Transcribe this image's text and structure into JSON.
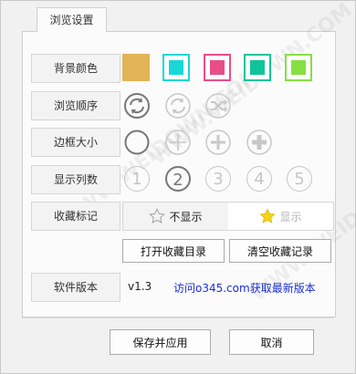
{
  "tab": {
    "label": "浏览设置"
  },
  "labels": {
    "bg_color": "背景颜色",
    "browse_order": "浏览顺序",
    "border_size": "边框大小",
    "columns": "显示列数",
    "favorite_mark": "收藏标记",
    "version": "软件版本"
  },
  "colors": {
    "swatches": [
      "#e2b457",
      "#18d8d8",
      "#e84d8a",
      "#0fc49a",
      "#86e042"
    ],
    "selected_index": 0
  },
  "browse_order": {
    "icons": [
      "repeat-icon",
      "refresh-icon",
      "shuffle-icon"
    ],
    "selected_index": 0
  },
  "border_size": {
    "icons": [
      "circle-icon",
      "plus-thin-icon",
      "plus-medium-icon",
      "plus-bold-icon"
    ],
    "selected_index": 0
  },
  "columns": {
    "options": [
      "1",
      "2",
      "3",
      "4",
      "5"
    ],
    "selected_index": 1
  },
  "favorite": {
    "hide_label": "不显示",
    "show_label": "显示",
    "selected": "hide"
  },
  "buttons": {
    "open_favorites": "打开收藏目录",
    "clear_favorites": "清空收藏记录",
    "save_apply": "保存并应用",
    "cancel": "取消"
  },
  "version": {
    "value": "v1.3",
    "link": "访问o345.com获取最新版本"
  },
  "watermark": "WWW.WEIDOWN.COM"
}
